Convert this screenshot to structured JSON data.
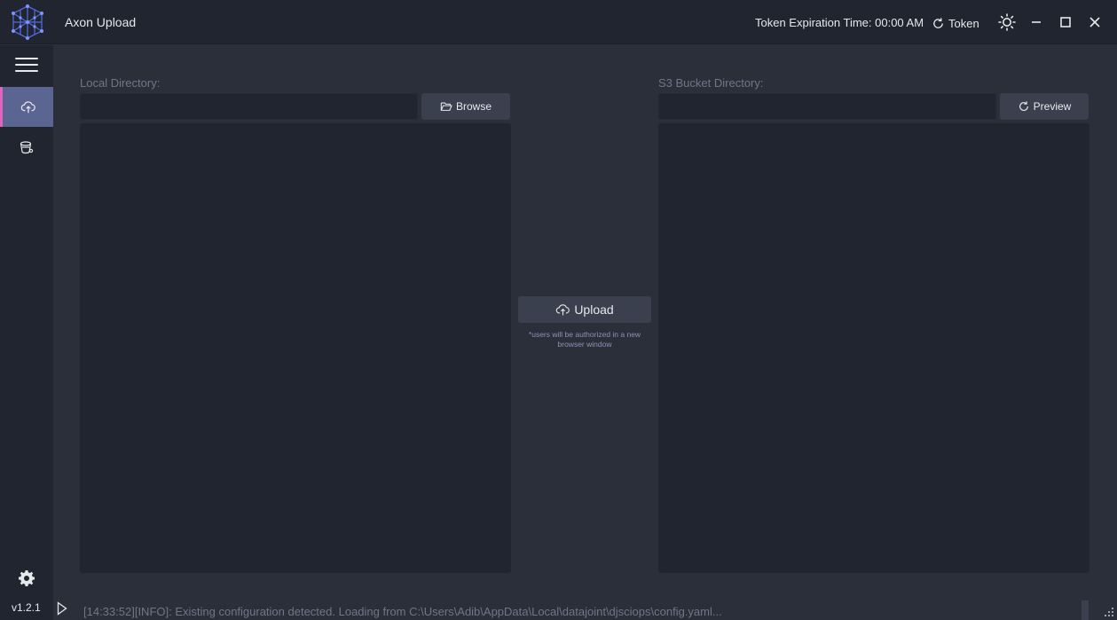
{
  "app": {
    "title": "Axon Upload",
    "token_expiration": "Token Expiration Time: 00:00 AM",
    "token_button": "Token",
    "version": "v1.2.1"
  },
  "icons": {
    "logo": "cube-network-logo",
    "theme": "sun-icon",
    "minimize": "minimize-icon",
    "maximize": "maximize-icon",
    "close": "close-icon",
    "menu": "hamburger-icon",
    "upload_nav": "cloud-upload-icon",
    "bucket_nav": "bucket-icon",
    "settings": "gear-icon"
  },
  "colors": {
    "accent": "#e462c0",
    "active_nav": "#5b6592",
    "background": "#2b2f3a",
    "panel": "#21252f"
  },
  "local": {
    "label": "Local Directory:",
    "value": "",
    "browse_label": "Browse"
  },
  "s3": {
    "label": "S3 Bucket Directory:",
    "value": "",
    "preview_label": "Preview"
  },
  "upload": {
    "label": "Upload",
    "note": "*users will be authorized in a new browser window"
  },
  "log": {
    "text": "[14:33:52][INFO]: Existing configuration detected. Loading from C:\\Users\\Adib\\AppData\\Local\\datajoint\\djsciops\\config.yaml..."
  }
}
